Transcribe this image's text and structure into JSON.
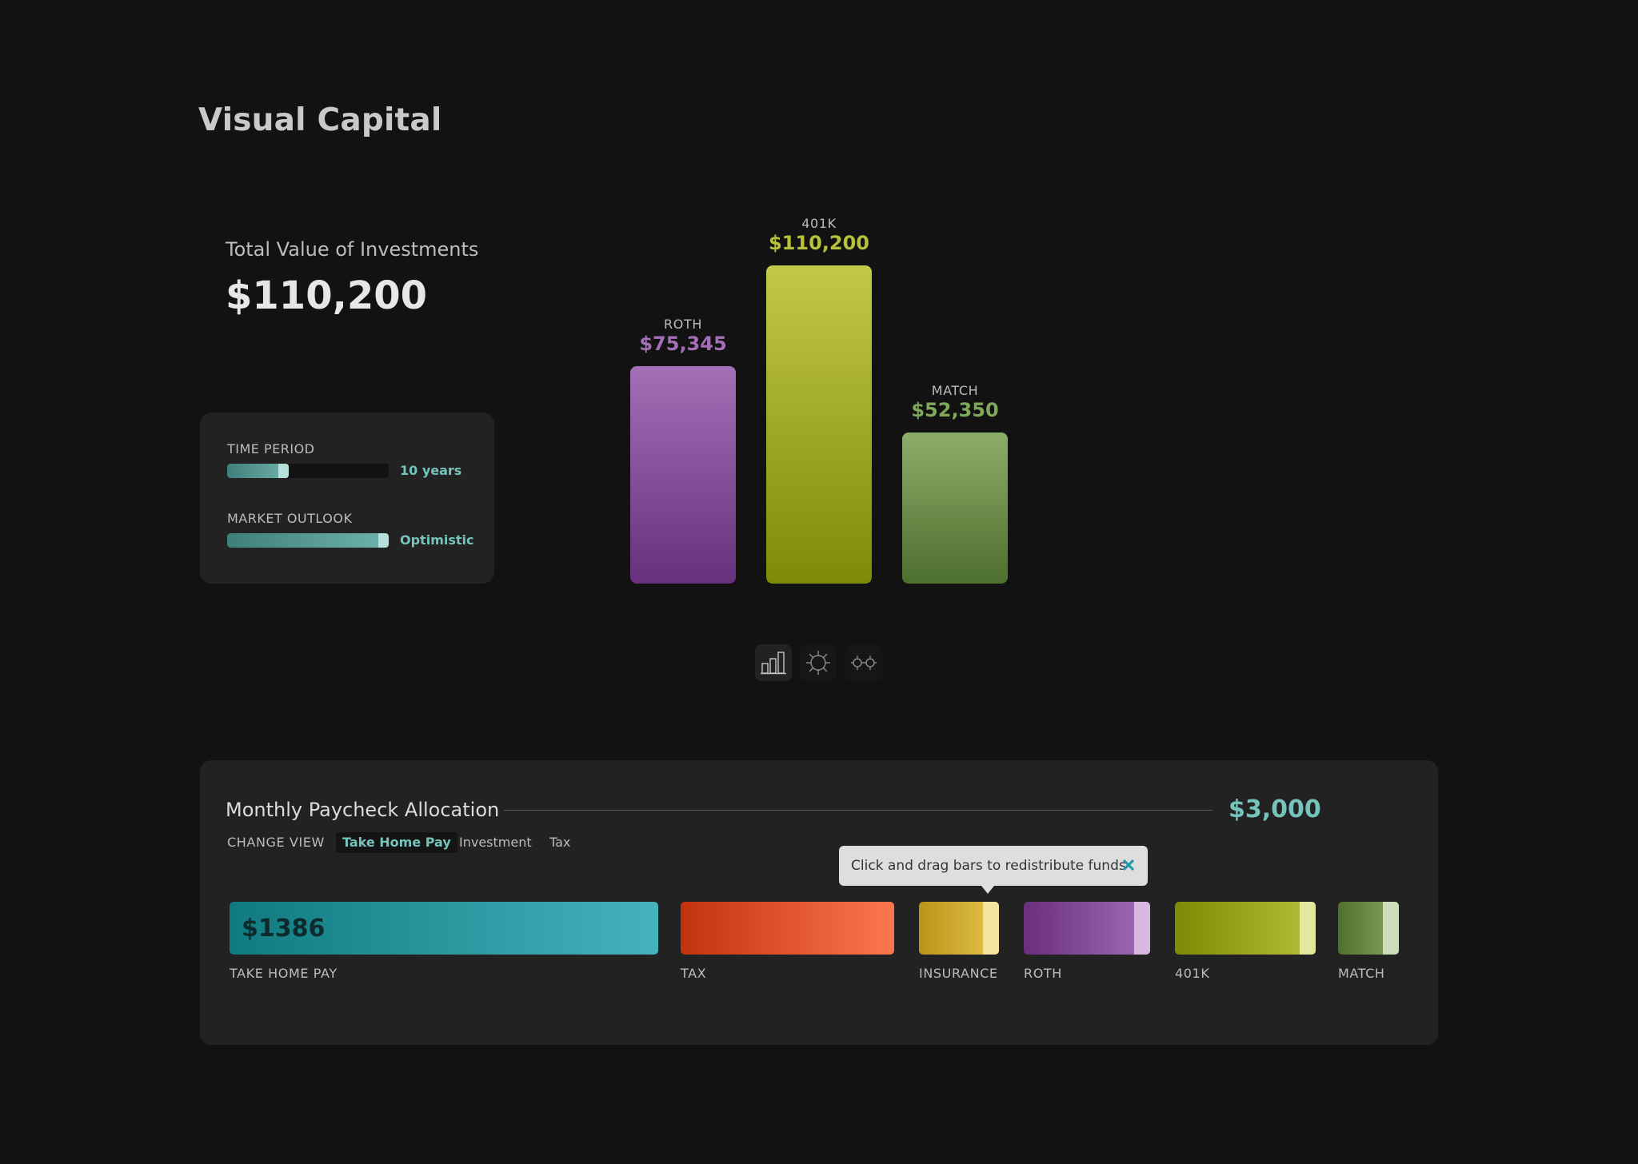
{
  "app": {
    "title": "Visual Capital"
  },
  "summary": {
    "total_label": "Total Value of Investments",
    "total_value": "$110,200"
  },
  "controls": {
    "time_period": {
      "label": "TIME PERIOD",
      "value_text": "10 years",
      "level": 0.38
    },
    "market_outlook": {
      "label": "MARKET OUTLOOK",
      "value_text": "Optimistic",
      "level": 1.0
    }
  },
  "chart_data": {
    "type": "bar",
    "title": "",
    "categories": [
      "ROTH",
      "401K",
      "MATCH"
    ],
    "values": [
      75345,
      110200,
      52350
    ],
    "value_labels": [
      "$75,345",
      "$110,200",
      "$52,350"
    ],
    "colors": [
      [
        "#a46fb7",
        "#66307c"
      ],
      [
        "#c3c84a",
        "#7e8a05"
      ],
      [
        "#8cad6a",
        "#4d6f2d"
      ]
    ],
    "value_colors": [
      "#a46fb7",
      "#b7c13a",
      "#7ea85a"
    ],
    "xlabel": "",
    "ylabel": "",
    "ylim": [
      0,
      110200
    ],
    "grid": false
  },
  "view_toggles": [
    {
      "name": "bar-chart-view-icon",
      "active": true
    },
    {
      "name": "radial-view-icon",
      "active": false
    },
    {
      "name": "compare-view-icon",
      "active": false
    }
  ],
  "allocation": {
    "title": "Monthly Paycheck Allocation",
    "total": "$3,000",
    "change_view_label": "CHANGE VIEW",
    "tabs": [
      {
        "label": "Take Home Pay",
        "active": true
      },
      {
        "label": "Investment",
        "active": false
      },
      {
        "label": "Tax",
        "active": false
      }
    ],
    "tooltip": "Click and drag bars to redistribute funds",
    "take_home_amount": "$1386",
    "bars": [
      {
        "label": "TAKE HOME PAY",
        "from": "#0f7a80",
        "to": "#45b2bc",
        "handle": null
      },
      {
        "label": "TAX",
        "from": "#c2320e",
        "to": "#fc7650",
        "handle": null
      },
      {
        "label": "INSURANCE",
        "from": "#b99518",
        "to": "#e6c44e",
        "handle": "#f5e3a0"
      },
      {
        "label": "ROTH",
        "from": "#6a2e7c",
        "to": "#a16db6",
        "handle": "#d7b8e1"
      },
      {
        "label": "401K",
        "from": "#7e8a05",
        "to": "#b6bf3a",
        "handle": "#e3e8a0"
      },
      {
        "label": "MATCH",
        "from": "#4f6f2d",
        "to": "#86a862",
        "handle": "#cddcbb"
      }
    ],
    "accent_color": "#74c4bc"
  }
}
